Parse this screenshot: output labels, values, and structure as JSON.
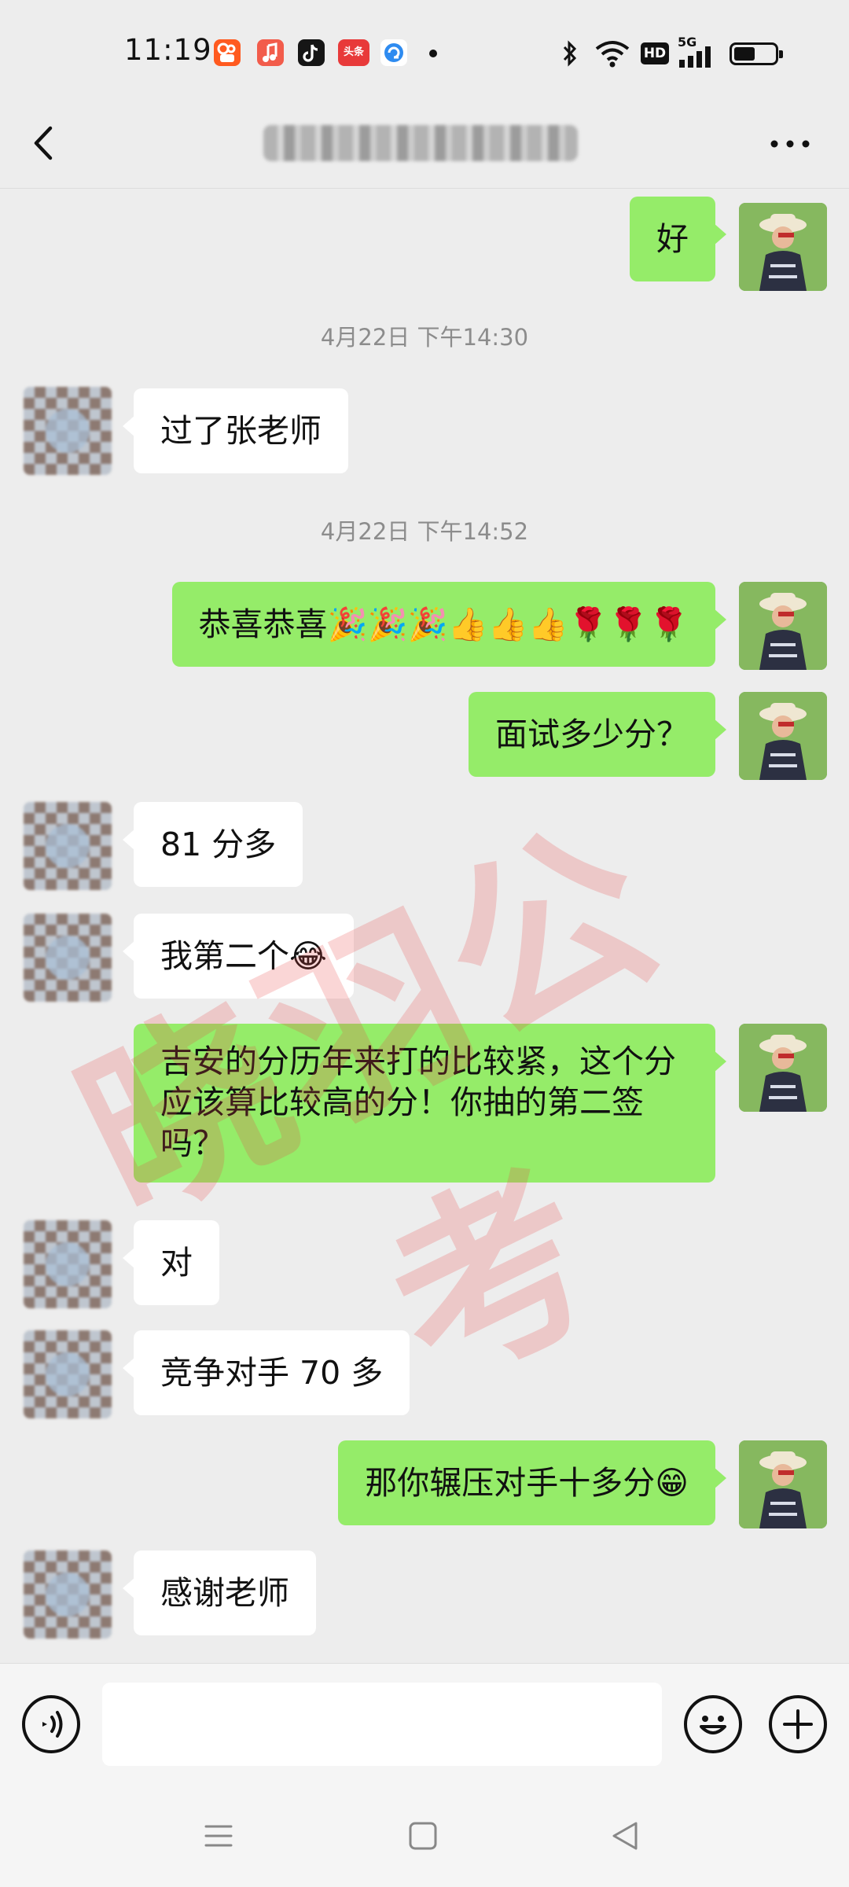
{
  "status_bar": {
    "time": "11:19",
    "apps": [
      {
        "icon": "kuaishou-icon",
        "color": "#ff5a1f",
        "text": ""
      },
      {
        "icon": "music-icon",
        "color": "#f25c4b",
        "text": ""
      },
      {
        "icon": "tiktok-icon",
        "color": "#161616",
        "text": ""
      },
      {
        "icon": "toutiao-icon",
        "color": "#e83a3a",
        "text": "头条"
      },
      {
        "icon": "browser-icon",
        "color": "#2e8bf0",
        "text": ""
      }
    ],
    "hd_label": "HD",
    "network_label": "5G"
  },
  "navbar": {
    "back_icon": "chevron-left-icon",
    "more_icon": "more-dots-icon"
  },
  "messages": [
    {
      "side": "self",
      "text": "好"
    },
    {
      "timestamp": "4月22日 下午14:30"
    },
    {
      "side": "other",
      "text": "过了张老师"
    },
    {
      "timestamp": "4月22日 下午14:52"
    },
    {
      "side": "self",
      "text": "恭喜恭喜🎉🎉🎉👍👍👍🌹🌹🌹"
    },
    {
      "side": "self",
      "text": "面试多少分？"
    },
    {
      "side": "other",
      "text": "81 分多"
    },
    {
      "side": "other",
      "text": "我第二个😂"
    },
    {
      "side": "self",
      "text": "吉安的分历年来打的比较紧，这个分应该算比较高的分！你抽的第二签吗？"
    },
    {
      "side": "other",
      "text": "对"
    },
    {
      "side": "other",
      "text": "竞争对手 70 多"
    },
    {
      "side": "self",
      "text": "那你辗压对手十多分😁"
    },
    {
      "side": "other",
      "text": "感谢老师"
    }
  ],
  "watermark": "晓羽公考",
  "input_bar": {
    "voice_icon": "voice-icon",
    "emoji_icon": "emoji-icon",
    "plus_icon": "plus-icon"
  },
  "system_nav": {
    "menu_icon": "menu-icon",
    "home_icon": "home-icon",
    "back_icon": "back-triangle-icon"
  }
}
